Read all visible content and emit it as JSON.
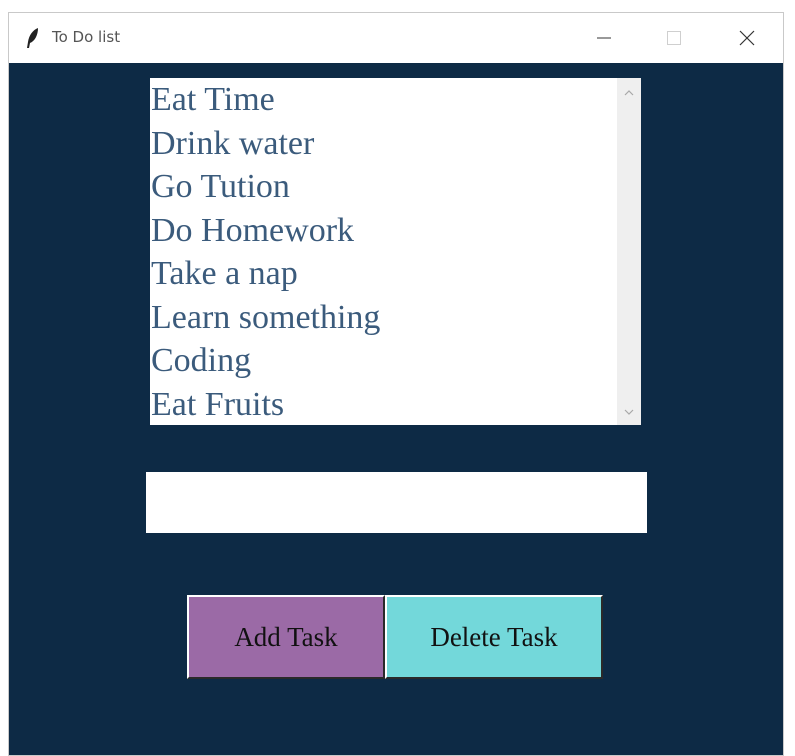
{
  "window": {
    "title": "To Do list",
    "icon": "feather-icon",
    "controls": [
      "minimize-icon",
      "maximize-icon",
      "close-icon"
    ]
  },
  "task_list": {
    "items": [
      "Eat Time",
      "Drink water",
      "Go Tution",
      "Do Homework",
      "Take a nap",
      "Learn something",
      "Coding",
      "Eat Fruits"
    ]
  },
  "task_input": {
    "value": "",
    "placeholder": ""
  },
  "buttons": {
    "add_label": "Add Task",
    "delete_label": "Delete Task"
  },
  "colors": {
    "background": "#0d2a45",
    "list_text": "#3b5b7c",
    "add_button": "#9b6aa6",
    "delete_button": "#73d8da"
  }
}
